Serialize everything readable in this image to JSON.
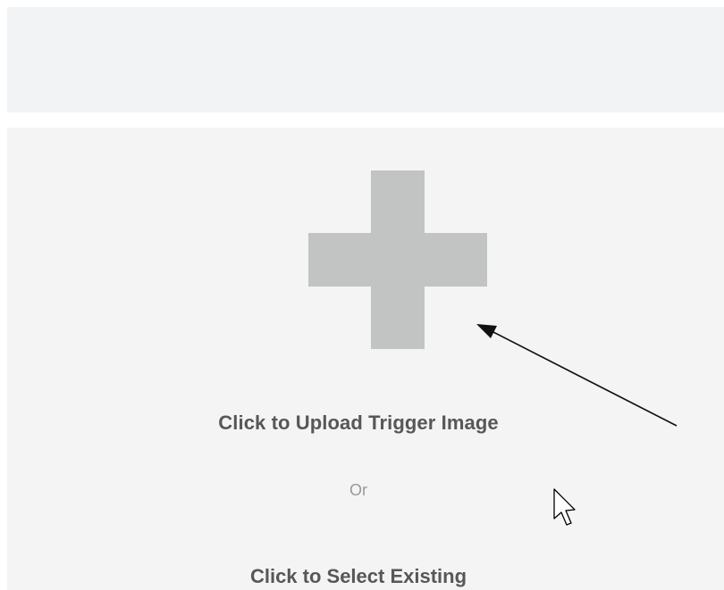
{
  "upload_panel": {
    "upload_label": "Click to Upload Trigger Image",
    "or_label": "Or",
    "select_label": "Click to Select Existing",
    "plus_icon": "plus-icon",
    "plus_color": "#c2c3c3"
  },
  "annotation": {
    "arrow_icon": "annotation-arrow",
    "cursor_icon": "mouse-pointer-icon"
  }
}
